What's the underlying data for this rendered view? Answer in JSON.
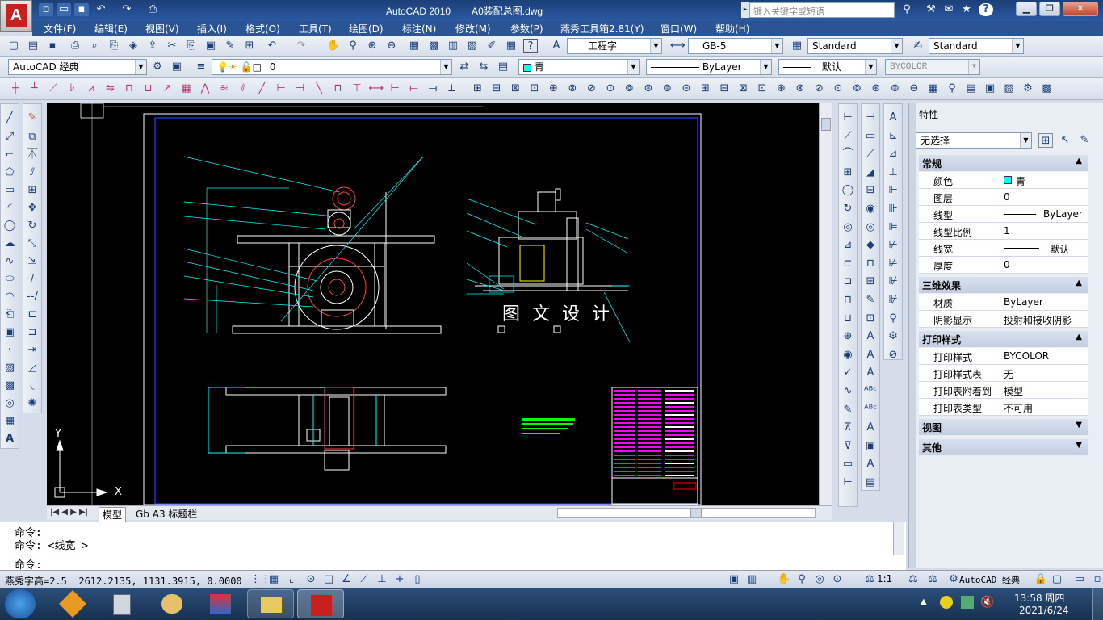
{
  "window": {
    "title": "AutoCAD 2010        A0装配总图.dwg",
    "search_placeholder": "键入关键字或短语",
    "app_logo_letter": "A"
  },
  "menu": [
    "文件(F)",
    "编辑(E)",
    "视图(V)",
    "插入(I)",
    "格式(O)",
    "工具(T)",
    "绘图(D)",
    "标注(N)",
    "修改(M)",
    "参数(P)",
    "燕秀工具箱2.81(Y)",
    "窗口(W)",
    "帮助(H)"
  ],
  "toolbar": {
    "text_style": "工程字",
    "dim_style": "GB-5",
    "table_style": "Standard",
    "multileader_style": "Standard",
    "workspace": "AutoCAD 经典",
    "layer": "0",
    "color": "青",
    "linetype": "ByLayer",
    "lineweight": "默认",
    "plotstyle": "BYCOLOR"
  },
  "drawing": {
    "watermark": "图 文 设 计",
    "axis_y": "Y",
    "axis_x": "X"
  },
  "layout_tabs": [
    "模型",
    "Gb A3 标题栏"
  ],
  "properties": {
    "title": "特性",
    "selection": "无选择",
    "sections": [
      {
        "name": "常规",
        "rows": [
          [
            "颜色",
            "青"
          ],
          [
            "图层",
            "0"
          ],
          [
            "线型",
            "ByLayer"
          ],
          [
            "线型比例",
            "1"
          ],
          [
            "线宽",
            "默认"
          ],
          [
            "厚度",
            "0"
          ]
        ]
      },
      {
        "name": "三维效果",
        "rows": [
          [
            "材质",
            "ByLayer"
          ],
          [
            "阴影显示",
            "投射和接收阴影"
          ]
        ]
      },
      {
        "name": "打印样式",
        "rows": [
          [
            "打印样式",
            "BYCOLOR"
          ],
          [
            "打印样式表",
            "无"
          ],
          [
            "打印表附着到",
            "模型"
          ],
          [
            "打印表类型",
            "不可用"
          ]
        ]
      },
      {
        "name": "视图",
        "rows": []
      },
      {
        "name": "其他",
        "rows": []
      }
    ]
  },
  "command": {
    "lines": [
      "命令:",
      "命令:  <线宽 >"
    ],
    "prompt": "命令:"
  },
  "status": {
    "left": "燕秀字高=2.5  2612.2135, 1131.3915, 0.0000",
    "scale": "1:1",
    "workspace": "AutoCAD 经典"
  },
  "taskbar": {
    "time": "13:58 周四",
    "date": "2021/6/24"
  },
  "colors": {
    "cyan": "#00ffff",
    "magenta": "#ff00ff",
    "white": "#ffffff",
    "red": "#ff0000",
    "blue": "#0000ff",
    "green": "#00ff00"
  }
}
